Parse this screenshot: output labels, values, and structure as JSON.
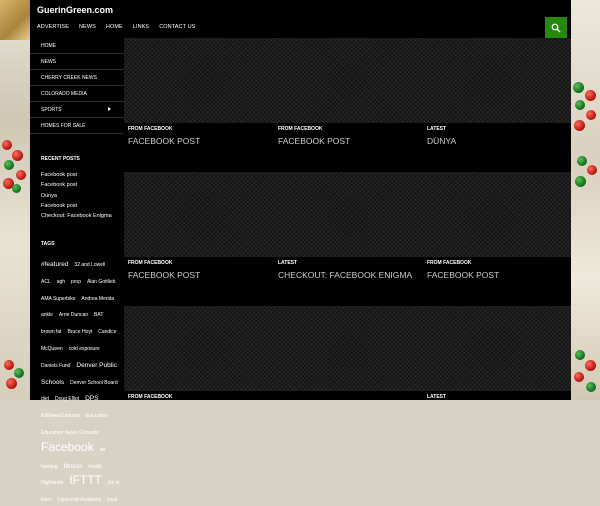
{
  "header": {
    "site_title": "GuerinGreen.com",
    "nav": [
      "Advertise",
      "News",
      "Home",
      "Links",
      "Contact Us"
    ]
  },
  "sidebar": {
    "menu": [
      {
        "label": "Home"
      },
      {
        "label": "News"
      },
      {
        "label": "Cherry Creek News"
      },
      {
        "label": "Colorado Media"
      },
      {
        "label": "Sports",
        "has_submenu": true
      },
      {
        "label": "Homes For Sale"
      }
    ],
    "recent_posts_title": "Recent Posts",
    "recent_posts": [
      "Facebook post",
      "Facebook post",
      "Dünya",
      "Facebook post",
      "Checkout: Facebook Enigma"
    ],
    "tags_title": "Tags",
    "tags": [
      {
        "t": "#featured",
        "s": 6.5
      },
      {
        "t": "32 and Lowell",
        "s": 5
      },
      {
        "t": "ACL",
        "s": 5
      },
      {
        "t": "agh",
        "s": 5
      },
      {
        "t": "prop",
        "s": 5
      },
      {
        "t": "Alan Gottlieb",
        "s": 5
      },
      {
        "t": "AMA Superbike",
        "s": 5
      },
      {
        "t": "Andrea Merida",
        "s": 5
      },
      {
        "t": "ankle",
        "s": 5
      },
      {
        "t": "Arne Duncan",
        "s": 5
      },
      {
        "t": "BAT",
        "s": 5
      },
      {
        "t": "brown fat",
        "s": 5
      },
      {
        "t": "Bruce Hoyt",
        "s": 5
      },
      {
        "t": "Candice McQueen",
        "s": 5
      },
      {
        "t": "cold exposure",
        "s": 5
      },
      {
        "t": "Daniels Fund",
        "s": 5
      },
      {
        "t": "Denver Public Schools",
        "s": 6.5
      },
      {
        "t": "Denver School Board",
        "s": 5
      },
      {
        "t": "diet",
        "s": 5
      },
      {
        "t": "Doug Elliot",
        "s": 5
      },
      {
        "t": "DPS",
        "s": 6.5
      },
      {
        "t": "EdNewsColorado",
        "s": 5
      },
      {
        "t": "Education",
        "s": 5
      },
      {
        "t": "Education News Colorado",
        "s": 5
      },
      {
        "t": "Facebook",
        "s": 12
      },
      {
        "t": "fat burning",
        "s": 5
      },
      {
        "t": "fitness",
        "s": 6.5
      },
      {
        "t": "health",
        "s": 5
      },
      {
        "t": "Highlands",
        "s": 5
      },
      {
        "t": "IFTTT",
        "s": 12
      },
      {
        "t": "iris in",
        "s": 5
      },
      {
        "t": "knee",
        "s": 5
      },
      {
        "t": "Lipscomb Academy",
        "s": 5
      },
      {
        "t": "local",
        "s": 5
      }
    ]
  },
  "main": {
    "rows": [
      {
        "tiles": [
          {
            "category": "From Facebook",
            "title": "Facebook post"
          },
          {
            "category": "From Facebook",
            "title": "Facebook post"
          },
          {
            "category": "Latest",
            "title": "Dünya"
          }
        ]
      },
      {
        "tiles": [
          {
            "category": "From Facebook",
            "title": "Facebook post"
          },
          {
            "category": "Latest",
            "title": "Checkout: Facebook Enigma"
          },
          {
            "category": "From Facebook",
            "title": "Facebook post"
          }
        ]
      },
      {
        "tiles": [
          {
            "category": "From Facebook",
            "title": ""
          },
          {
            "category": "",
            "title": ""
          },
          {
            "category": "Latest",
            "title": ""
          }
        ]
      }
    ]
  },
  "colors": {
    "accent": "#24890d",
    "background": "#000000",
    "text": "#ffffff"
  },
  "icons": {
    "search": "search-icon",
    "submenu": "chevron-right-icon"
  }
}
